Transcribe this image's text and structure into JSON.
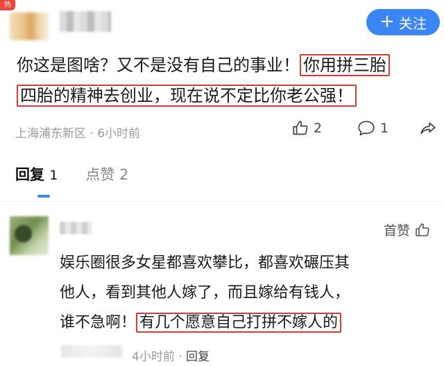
{
  "badge": {
    "hot": "热"
  },
  "header": {
    "follow_label": "关注"
  },
  "comment": {
    "text_before": "你这是图啥？又不是没有自己的事业！",
    "highlight_1": "你用拼三胎",
    "highlight_2": "四胎的精神去创业，现在说不定比你老公强！",
    "location": "上海浦东新区",
    "separator": "·",
    "time": "6小时前",
    "like_count": "2",
    "comment_count": "1"
  },
  "tabs": {
    "replies_label": "回复",
    "replies_count": "1",
    "likes_label": "点赞",
    "likes_count": "2"
  },
  "reply": {
    "first_like_label": "首赞",
    "text_line_1": "娱乐圈很多女星都喜欢攀比，都喜欢碾压其",
    "text_line_2": "他人，看到其他人嫁了，而且嫁给有钱人，",
    "text_before_hl": "谁不急啊！",
    "highlight": "有几个愿意自己打拼不嫁人的",
    "time": "4小时前",
    "separator": "·",
    "reply_label": "回复"
  },
  "icons": {
    "like": "thumbs-up-icon",
    "comment": "comment-bubble-icon",
    "share": "share-arrow-icon"
  },
  "colors": {
    "accent": "#3a86f5",
    "highlight_border": "#d63a3a",
    "badge": "#f0463c"
  }
}
